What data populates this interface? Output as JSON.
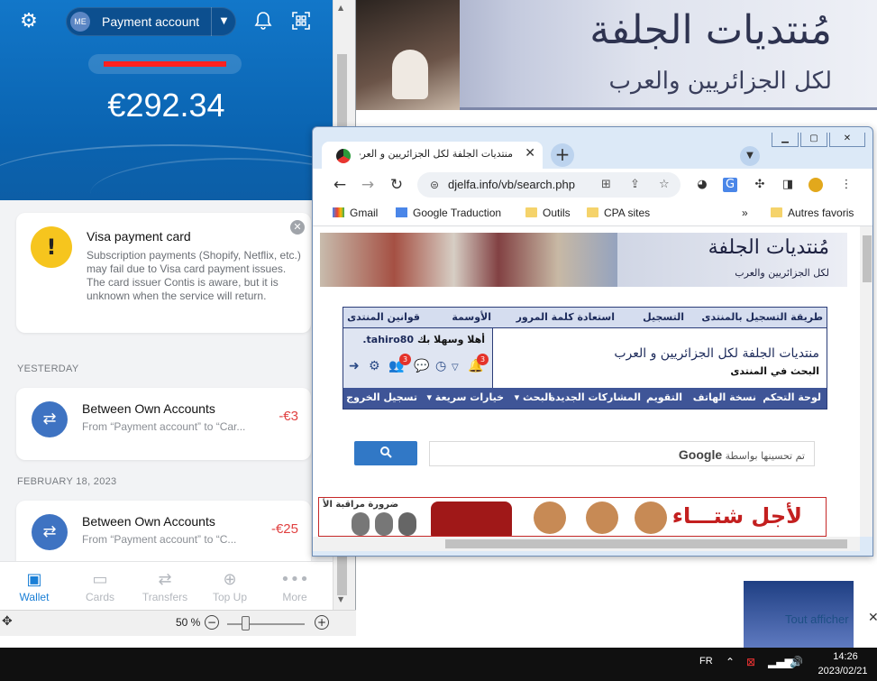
{
  "background_site": {
    "logo_main": "مُنتديات الجلفة",
    "logo_sub": "لكل الجزائريين والعرب",
    "tout_afficher": "Tout afficher",
    "tout_close": "✕"
  },
  "wallet": {
    "account_initials": "ME",
    "account_name": "Payment account",
    "balance": "€292.34",
    "notice": {
      "title": "Visa payment card",
      "body": "Subscription payments (Shopify, Netflix, etc.) may fail due to Visa card payment issues. The card issuer Contis is aware, but it is unknown when the service will return."
    },
    "sections": [
      {
        "label": "YESTERDAY",
        "transactions": [
          {
            "title": "Between Own Accounts",
            "subtitle": "From “Payment account” to “Car...",
            "amount": "-€3"
          }
        ]
      },
      {
        "label": "FEBRUARY 18, 2023",
        "transactions": [
          {
            "title": "Between Own Accounts",
            "subtitle": "From “Payment account” to “C...",
            "amount": "-€25"
          }
        ]
      }
    ],
    "tabs": [
      {
        "label": "Wallet",
        "icon": "wallet-icon"
      },
      {
        "label": "Cards",
        "icon": "cards-icon"
      },
      {
        "label": "Transfers",
        "icon": "transfers-icon"
      },
      {
        "label": "Top Up",
        "icon": "top-up-icon"
      },
      {
        "label": "More",
        "icon": "more-icon"
      }
    ],
    "zoom": "50 %"
  },
  "chrome": {
    "tab_title": "منتديات الجلفة لكل الجزائريين و العرب - البـ",
    "url": "djelfa.info/vb/search.php",
    "bookmarks": [
      "Gmail",
      "Google Traduction",
      "Outils",
      "CPA sites",
      "Autres favoris"
    ],
    "forum": {
      "nav": [
        "طريقة التسجيل بالمنتدى",
        "التسجيل",
        "استعادة كلمة المرور",
        "الأوسمة",
        "قوانين المنتدى"
      ],
      "welcome": "أهلا وسهلا بك",
      "username": "tahiro80.",
      "title": "منتديات الجلفة لكل الجزائريين و العرب",
      "search_label": "البحث في المنتدى",
      "badge_1": "3",
      "badge_2": "3",
      "bar": [
        "لوحة التحكم",
        "نسخة الهاتف",
        "التقويم",
        "المشاركات الجديدة",
        "البحث ▾",
        "خيارات سريعة ▾",
        "تسجيل الخروج"
      ]
    },
    "google_search": {
      "label_prefix": "تم تحسينها بواسطة",
      "label_brand": "Google"
    },
    "ad": {
      "left_text": "ضرورة مراقبة الأ",
      "right_text": "لأجل شتـــاء"
    }
  },
  "taskbar": {
    "language": "FR",
    "time": "14:26",
    "date": "2023/02/21"
  }
}
